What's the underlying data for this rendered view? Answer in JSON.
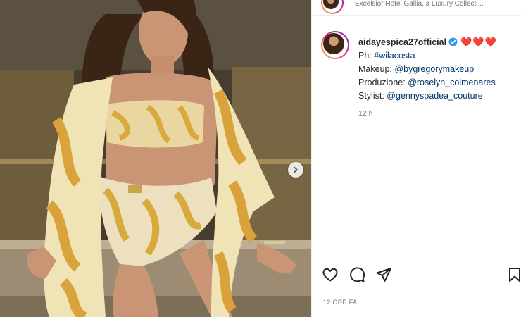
{
  "header": {
    "location": "Excelsior Hotel Gallia, a Luxury Collecti..."
  },
  "post": {
    "username": "aidayespica27official",
    "hearts": "❤️❤️❤️",
    "lines": [
      {
        "prefix": "Ph: ",
        "link": "#wilacosta"
      },
      {
        "prefix": "Makeup: ",
        "link": "@bygregorymakeup"
      },
      {
        "prefix": "Produzione: ",
        "link": "@roselyn_colmenares"
      },
      {
        "prefix": "Stylist: ",
        "link": "@gennyspadea_couture"
      }
    ],
    "time": "12 h"
  },
  "footer": {
    "date": "12 ORE FA"
  },
  "colors": {
    "verified": "#3897f0",
    "heart": "#e0245e",
    "link": "#00376b"
  },
  "icons": [
    "next-arrow-icon",
    "heart-icon",
    "comment-icon",
    "share-icon",
    "bookmark-icon",
    "verified-icon"
  ]
}
